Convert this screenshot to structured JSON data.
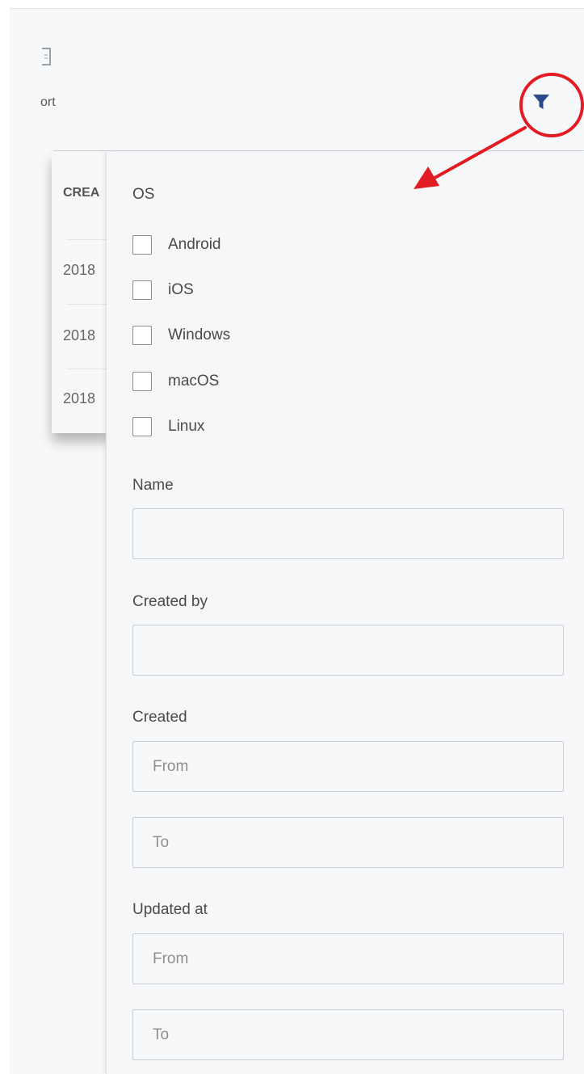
{
  "toolbar": {
    "export_label": "ort",
    "export_icon": "export-icon",
    "filter_icon": "filter-funnel-icon"
  },
  "table": {
    "header": "CREA",
    "rows": [
      "2018",
      "2018",
      "2018"
    ]
  },
  "filters": {
    "os": {
      "label": "OS",
      "options": [
        "Android",
        "iOS",
        "Windows",
        "macOS",
        "Linux"
      ]
    },
    "name": {
      "label": "Name",
      "value": ""
    },
    "created_by": {
      "label": "Created by",
      "value": ""
    },
    "created": {
      "label": "Created",
      "from_placeholder": "From",
      "to_placeholder": "To"
    },
    "updated_at": {
      "label": "Updated at",
      "from_placeholder": "From",
      "to_placeholder": "To"
    }
  },
  "annotation": {
    "color": "#e31b23"
  },
  "colors": {
    "accent": "#2b4a8c",
    "panel_bg": "#f5f7f9"
  }
}
